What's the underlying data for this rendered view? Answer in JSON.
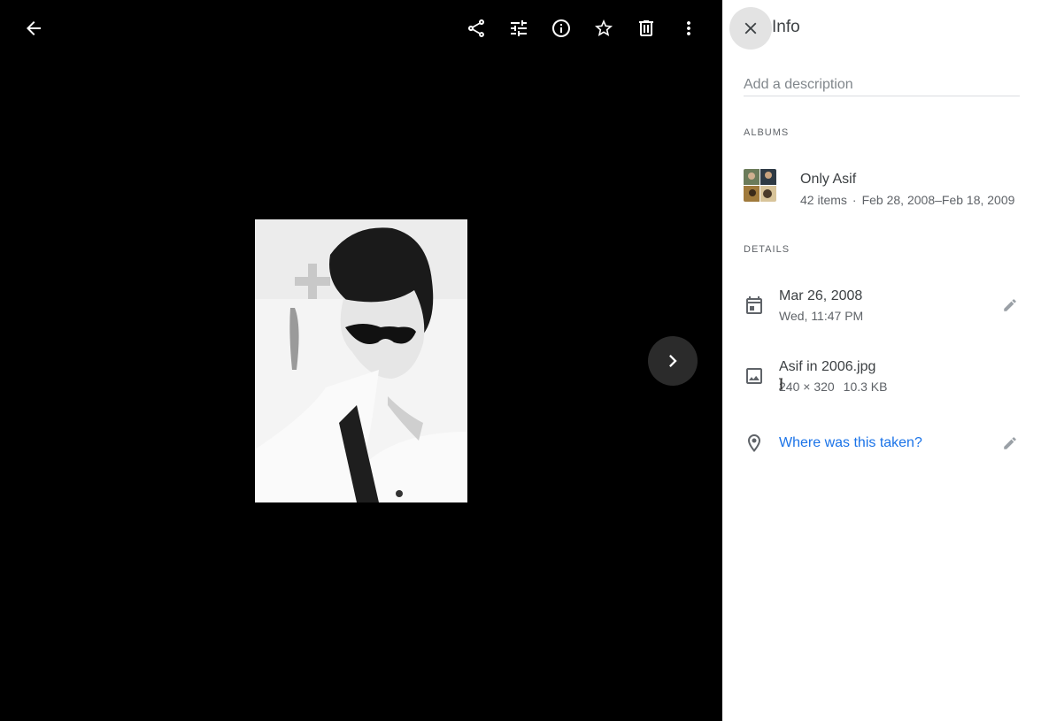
{
  "viewer": {
    "back_icon": "arrow-back-icon",
    "toolbar": [
      {
        "icon": "share-icon"
      },
      {
        "icon": "edit-sliders-icon"
      },
      {
        "icon": "info-icon"
      },
      {
        "icon": "star-icon"
      },
      {
        "icon": "trash-icon"
      },
      {
        "icon": "more-vert-icon"
      }
    ],
    "next_icon": "chevron-right-icon"
  },
  "info_panel": {
    "title": "Info",
    "close_icon": "close-icon",
    "description_placeholder": "Add a description",
    "albums_label": "ALBUMS",
    "album": {
      "name": "Only Asif",
      "items": "42 items",
      "separator": "·",
      "date_range": "Feb 28, 2008–Feb 18, 2009"
    },
    "details_label": "DETAILS",
    "date": {
      "icon": "calendar-icon",
      "primary": "Mar 26, 2008",
      "secondary": "Wed, 11:47 PM"
    },
    "file": {
      "icon": "image-icon",
      "name": "Asif in 2006.jpg",
      "dimensions": "240 × 320",
      "size": "10.3 KB"
    },
    "location": {
      "icon": "location-pin-icon",
      "prompt": "Where was this taken?"
    },
    "colors": {
      "link": "#1a73e8",
      "text_primary": "#3c4043",
      "text_secondary": "#5f6368"
    }
  }
}
